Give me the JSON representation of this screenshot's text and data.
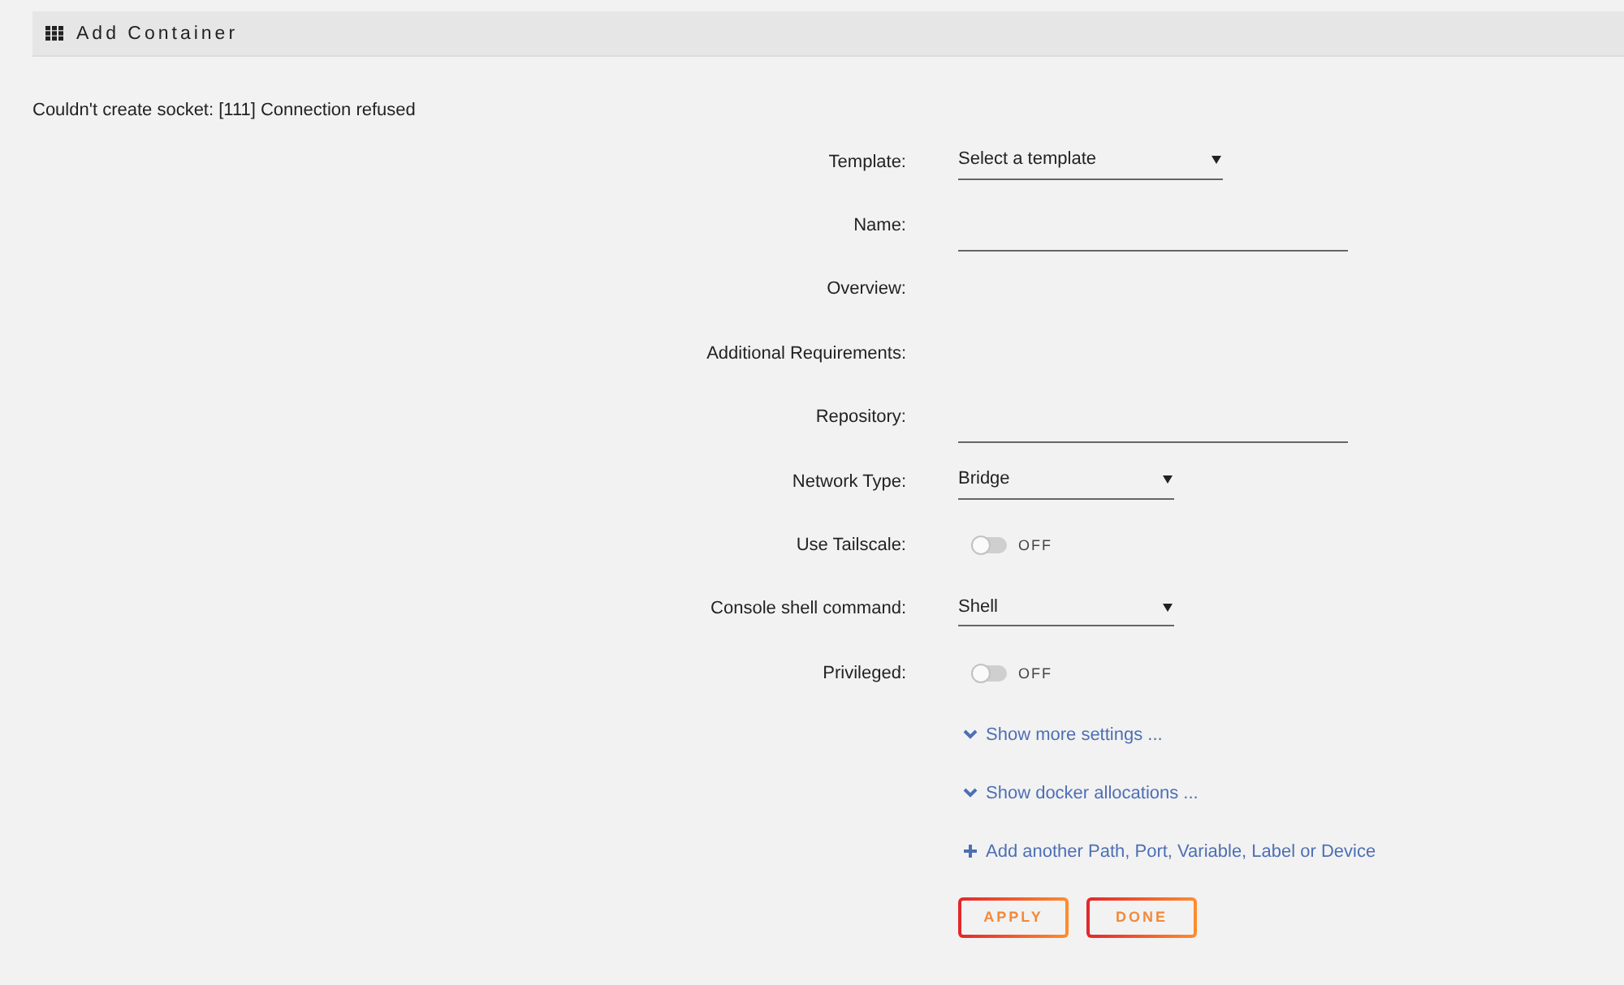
{
  "header": {
    "title": "Add Container"
  },
  "error": "Couldn't create socket: [111] Connection refused",
  "fields": [
    {
      "kind": "select",
      "label": "Template:",
      "value": "Select a template"
    },
    {
      "kind": "input",
      "label": "Name:"
    },
    {
      "kind": "text",
      "label": "Overview:"
    },
    {
      "kind": "text",
      "label": "Additional Requirements:"
    },
    {
      "kind": "input",
      "label": "Repository:"
    },
    {
      "kind": "select",
      "label": "Network Type:",
      "value": "Bridge"
    },
    {
      "kind": "toggle",
      "label": "Use Tailscale:",
      "on": false,
      "state_label": "OFF"
    },
    {
      "kind": "select",
      "label": "Console shell command:",
      "value": "Shell"
    },
    {
      "kind": "toggle",
      "label": "Privileged:",
      "on": false,
      "state_label": "OFF"
    }
  ],
  "links": [
    {
      "kind": "expand",
      "text": "Show more settings ..."
    },
    {
      "kind": "expand",
      "text": "Show docker allocations ..."
    },
    {
      "kind": "add",
      "text": "Add another Path, Port, Variable, Label or Device"
    }
  ],
  "buttons": [
    "APPLY",
    "DONE"
  ]
}
